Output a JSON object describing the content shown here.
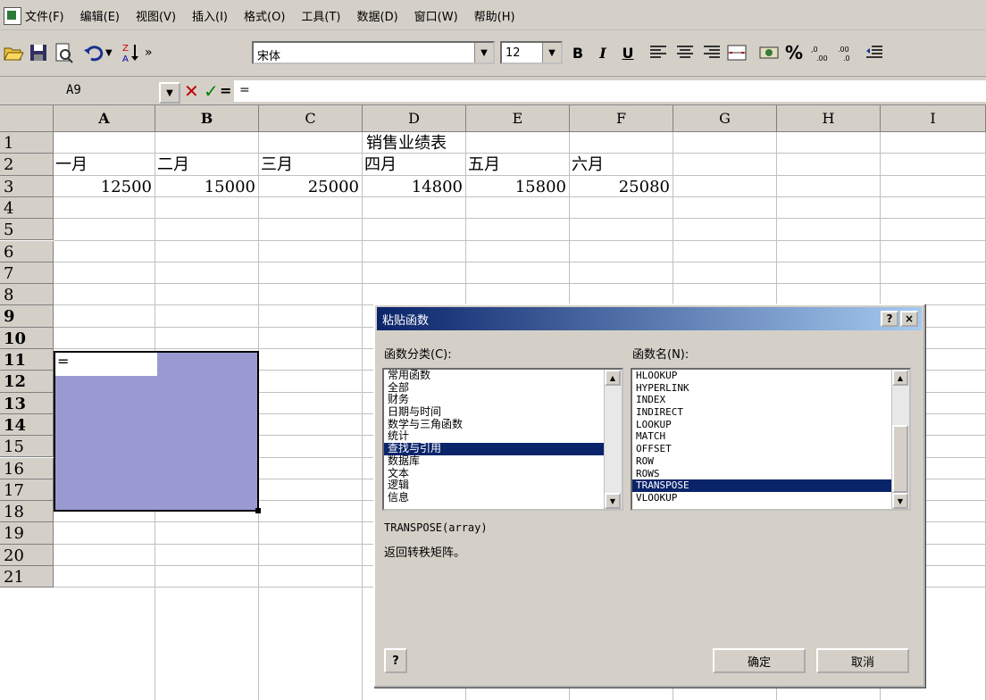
{
  "menubar": {
    "items": [
      "文件(F)",
      "编辑(E)",
      "视图(V)",
      "插入(I)",
      "格式(O)",
      "工具(T)",
      "数据(D)",
      "窗口(W)",
      "帮助(H)"
    ]
  },
  "toolbar": {
    "font_name": "宋体",
    "font_size": "12",
    "bold": "B",
    "italic": "I",
    "underline": "U",
    "percent": "%",
    "more": "»"
  },
  "formula_bar": {
    "cell_ref": "A9",
    "cancel_symbol": "✕",
    "enter_symbol": "✓",
    "equals_symbol": "=",
    "formula": "="
  },
  "sheet": {
    "columns": [
      "A",
      "B",
      "C",
      "D",
      "E",
      "F",
      "G",
      "H",
      "I"
    ],
    "rows": [
      "1",
      "2",
      "3",
      "4",
      "5",
      "6",
      "7",
      "8",
      "9",
      "10",
      "11",
      "12",
      "13",
      "14",
      "15",
      "16",
      "17",
      "18",
      "19",
      "20",
      "21"
    ],
    "title": "销售业绩表",
    "months": [
      "一月",
      "二月",
      "三月",
      "四月",
      "五月",
      "六月"
    ],
    "values": [
      "12500",
      "15000",
      "25000",
      "14800",
      "15800",
      "25080"
    ],
    "active_cell_value": "="
  },
  "dialog": {
    "title": "粘贴函数",
    "help_btn": "?",
    "close_btn": "×",
    "category_label": "函数分类(C):",
    "categories": [
      "常用函数",
      "全部",
      "财务",
      "日期与时间",
      "数学与三角函数",
      "统计",
      "查找与引用",
      "数据库",
      "文本",
      "逻辑",
      "信息"
    ],
    "selected_category": 6,
    "function_label": "函数名(N):",
    "functions": [
      "HLOOKUP",
      "HYPERLINK",
      "INDEX",
      "INDIRECT",
      "LOOKUP",
      "MATCH",
      "OFFSET",
      "ROW",
      "ROWS",
      "TRANSPOSE",
      "VLOOKUP"
    ],
    "selected_function": 9,
    "signature": "TRANSPOSE(array)",
    "description": "返回转秩矩阵。",
    "help_icon": "?",
    "ok_label": "确定",
    "cancel_label": "取消"
  }
}
